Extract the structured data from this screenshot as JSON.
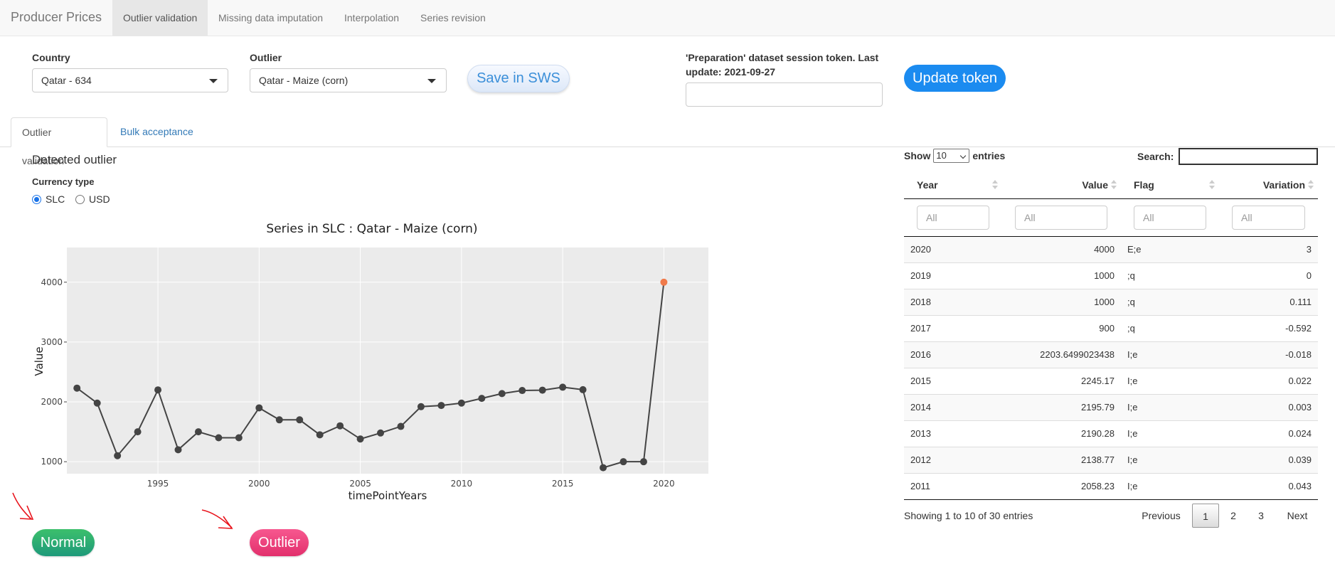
{
  "navbar": {
    "brand": "Producer Prices",
    "tabs": [
      {
        "label": "Outlier validation",
        "active": true
      },
      {
        "label": "Missing data imputation",
        "active": false
      },
      {
        "label": "Interpolation",
        "active": false
      },
      {
        "label": "Series revision",
        "active": false
      }
    ]
  },
  "controls": {
    "country_label": "Country",
    "country_value": "Qatar - 634",
    "outlier_label": "Outlier",
    "outlier_value": "Qatar - Maize (corn)",
    "save_button": "Save in SWS",
    "token_label": "'Preparation' dataset session token. Last update: 2021-09-27",
    "token_value": "",
    "update_button": "Update token"
  },
  "subtabs": [
    {
      "label": "Outlier validation",
      "active": true
    },
    {
      "label": "Bulk acceptance",
      "active": false
    }
  ],
  "detected": {
    "title": "Detected outlier",
    "currency_label": "Currency type",
    "options": [
      "SLC",
      "USD"
    ],
    "selected": "SLC"
  },
  "chart_data": {
    "type": "line",
    "title": "Series in  SLC : Qatar  -  Maize (corn)",
    "xlabel": "timePointYears",
    "ylabel": "Value",
    "xlim": [
      1990.5,
      2022.2
    ],
    "ylim": [
      800,
      4580
    ],
    "xticks": [
      1995,
      2000,
      2005,
      2010,
      2015,
      2020
    ],
    "yticks": [
      1000,
      2000,
      3000,
      4000
    ],
    "grid": true,
    "x": [
      1991,
      1992,
      1993,
      1994,
      1995,
      1996,
      1997,
      1998,
      1999,
      2000,
      2001,
      2002,
      2003,
      2004,
      2005,
      2006,
      2007,
      2008,
      2009,
      2010,
      2011,
      2012,
      2013,
      2014,
      2015,
      2016,
      2017,
      2018,
      2019,
      2020
    ],
    "y": [
      2230,
      1980,
      1100,
      1500,
      2200,
      1200,
      1500,
      1400,
      1400,
      1900,
      1700,
      1700,
      1450,
      1600,
      1380,
      1480,
      1590,
      1920,
      1940,
      1980,
      2058.23,
      2138.77,
      2190.28,
      2195.79,
      2245.17,
      2203.65,
      900,
      1000,
      1000,
      4000
    ],
    "line_color": "#444444",
    "point_color": "#444444",
    "outlier_index": 29,
    "outlier_color": "#f07a4a",
    "panel_bg": "#ebebeb"
  },
  "buttons": {
    "normal": "Normal",
    "outlier": "Outlier"
  },
  "table": {
    "show_label": "Show",
    "entries_value": "10",
    "entries_label": "entries",
    "search_label": "Search:",
    "columns": [
      "Year",
      "Value",
      "Flag",
      "Variation"
    ],
    "filter_placeholder": "All",
    "rows": [
      [
        "2020",
        "4000",
        "E;e",
        "3"
      ],
      [
        "2019",
        "1000",
        ";q",
        "0"
      ],
      [
        "2018",
        "1000",
        ";q",
        "0.111"
      ],
      [
        "2017",
        "900",
        ";q",
        "-0.592"
      ],
      [
        "2016",
        "2203.6499023438",
        "I;e",
        "-0.018"
      ],
      [
        "2015",
        "2245.17",
        "I;e",
        "0.022"
      ],
      [
        "2014",
        "2195.79",
        "I;e",
        "0.003"
      ],
      [
        "2013",
        "2190.28",
        "I;e",
        "0.024"
      ],
      [
        "2012",
        "2138.77",
        "I;e",
        "0.039"
      ],
      [
        "2011",
        "2058.23",
        "I;e",
        "0.043"
      ]
    ],
    "info": "Showing 1 to 10 of 30 entries",
    "pagination": [
      "Previous",
      "1",
      "2",
      "3",
      "Next"
    ],
    "current_page": "1"
  }
}
